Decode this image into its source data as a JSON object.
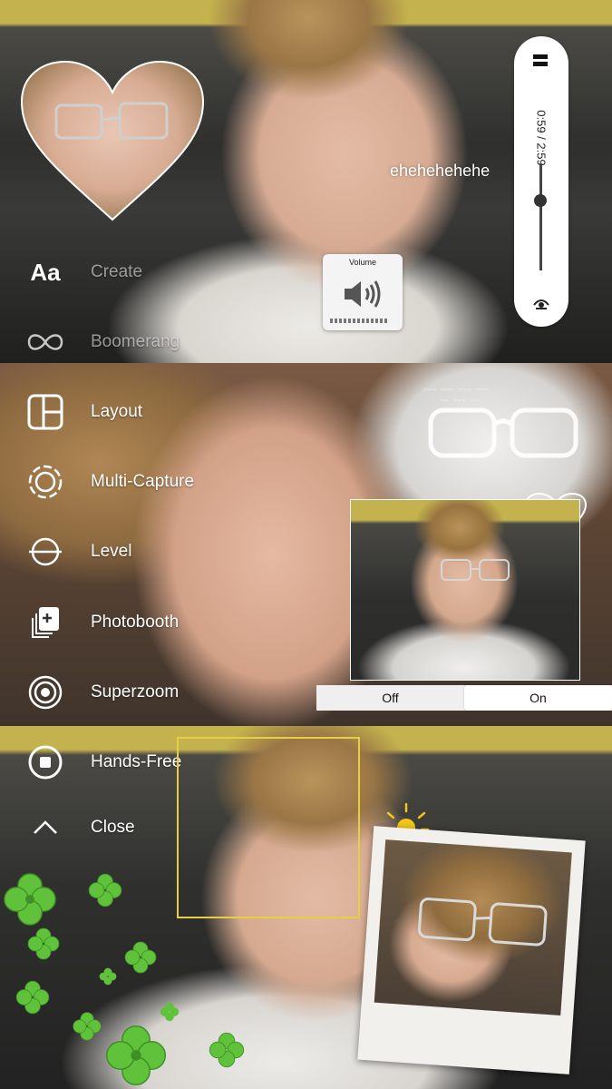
{
  "overlay": {
    "caption": "ehehehehehe"
  },
  "player": {
    "time": "0:59 / 2:59",
    "progress_fraction": 0.33
  },
  "volume_hud": {
    "title": "Volume",
    "level_fraction": 0.9
  },
  "menu": {
    "items": [
      {
        "id": "create",
        "label": "Create",
        "icon": "text-aa-icon",
        "glyph": "Aa"
      },
      {
        "id": "boomerang",
        "label": "Boomerang",
        "icon": "infinity-icon"
      },
      {
        "id": "layout",
        "label": "Layout",
        "icon": "layout-grid-icon"
      },
      {
        "id": "multi-capture",
        "label": "Multi-Capture",
        "icon": "multi-capture-icon"
      },
      {
        "id": "level",
        "label": "Level",
        "icon": "level-icon"
      },
      {
        "id": "photobooth",
        "label": "Photobooth",
        "icon": "photobooth-icon"
      },
      {
        "id": "superzoom",
        "label": "Superzoom",
        "icon": "superzoom-icon"
      },
      {
        "id": "hands-free",
        "label": "Hands-Free",
        "icon": "hands-free-icon"
      },
      {
        "id": "close",
        "label": "Close",
        "icon": "chevron-up-icon"
      }
    ]
  },
  "toggle": {
    "off_label": "Off",
    "on_label": "On",
    "selected": "On"
  },
  "colors": {
    "focus_frame": "#e6cf44",
    "sun": "#f2c516",
    "clover": "#5fc23a",
    "player_bg": "#ffffff"
  },
  "stickers": [
    "heart-frame-icon",
    "glasses-sticker-icon",
    "sun-icon",
    "clover-icon",
    "polaroid-frame"
  ]
}
